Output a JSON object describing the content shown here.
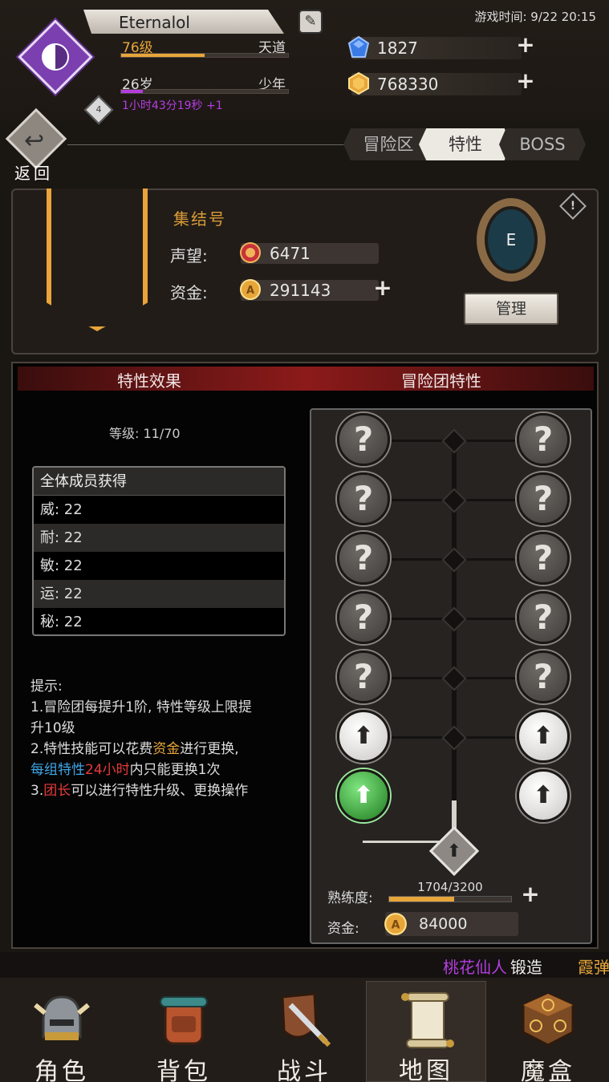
{
  "header": {
    "player_name": "Eternalol",
    "avatar_badge": "4",
    "level": "76级",
    "level_progress": 0.5,
    "realm": "天道",
    "age": "26岁",
    "age_stage": "少年",
    "age_progress": 0.13,
    "timer": "1小时43分19秒 +1",
    "game_time": "游戏时间: 9/22 20:15",
    "gems": "1827",
    "gold": "768330"
  },
  "nav_back": {
    "label": "返回"
  },
  "tabs": [
    {
      "label": "冒险区"
    },
    {
      "label": "特性"
    },
    {
      "label": "BOSS"
    }
  ],
  "guild": {
    "name": "集结号",
    "reputation_label": "声望:",
    "reputation_value": "6471",
    "funds_label": "资金:",
    "funds_value": "291143",
    "emblem_letter": "E",
    "manage_label": "管理"
  },
  "traits": {
    "effect_title": "特性效果",
    "team_title": "冒险团特性",
    "level_line": "等级: 11/70",
    "stats_header": "全体成员获得",
    "stats": [
      {
        "text": "威: 22"
      },
      {
        "text": "耐: 22"
      },
      {
        "text": "敏: 22"
      },
      {
        "text": "运: 22"
      },
      {
        "text": "秘: 22"
      }
    ],
    "tips_title": "提示:",
    "tip1": "1.冒险团每提升1阶, 特性等级上限提升10级",
    "tip2_a": "2.特性技能可以花费",
    "tip2_gold": "资金",
    "tip2_b": "进行更换,",
    "tip2_blue": "每组特性",
    "tip2_red": "24小时",
    "tip2_c": "内只能更换1次",
    "tip3_a": "3.",
    "tip3_red": "团长",
    "tip3_b": "可以进行特性升级、更换操作",
    "unknown_mark": "?",
    "proficiency_label": "熟练度:",
    "proficiency_value": "1704/3200",
    "proficiency_progress": 0.53,
    "cost_label": "资金:",
    "cost_value": "84000"
  },
  "ticker": {
    "name": "桃花仙人",
    "action": "锻造",
    "item": "霞弹"
  },
  "bottom_nav": [
    {
      "label": "角色"
    },
    {
      "label": "背包"
    },
    {
      "label": "战斗"
    },
    {
      "label": "地图"
    },
    {
      "label": "魔盒"
    }
  ],
  "colors": {
    "accent_gold": "#e7a63a",
    "accent_purple": "#b43de0",
    "highlight_red": "#e63a3a",
    "highlight_blue": "#3fa6e6"
  }
}
